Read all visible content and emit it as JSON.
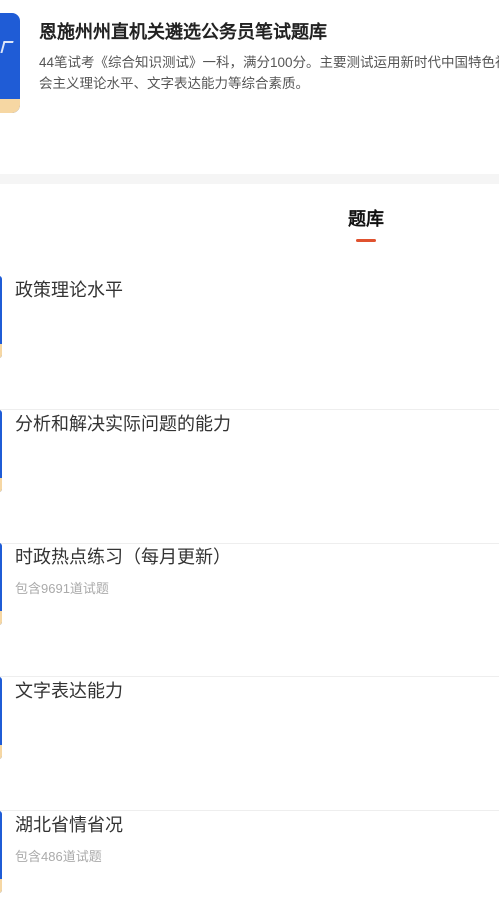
{
  "header": {
    "title": "恩施州州直机关遴选公务员笔试题库",
    "description": "44笔试考《综合知识测试》一科，满分100分。主要测试运用新时代中国特色社会主义理论水平、文字表达能力等综合素质。",
    "cover_color": "#1f5cd6"
  },
  "tabs": [
    {
      "label": "题库",
      "active": true
    }
  ],
  "accent_color": "#e0522f",
  "bank_items": [
    {
      "title": "政策理论水平",
      "subtitle": ""
    },
    {
      "title": "分析和解决实际问题的能力",
      "subtitle": ""
    },
    {
      "title": "时政热点练习（每月更新）",
      "subtitle": "包含9691道试题"
    },
    {
      "title": "文字表达能力",
      "subtitle": ""
    },
    {
      "title": "湖北省情省况",
      "subtitle": "包含486道试题"
    }
  ]
}
